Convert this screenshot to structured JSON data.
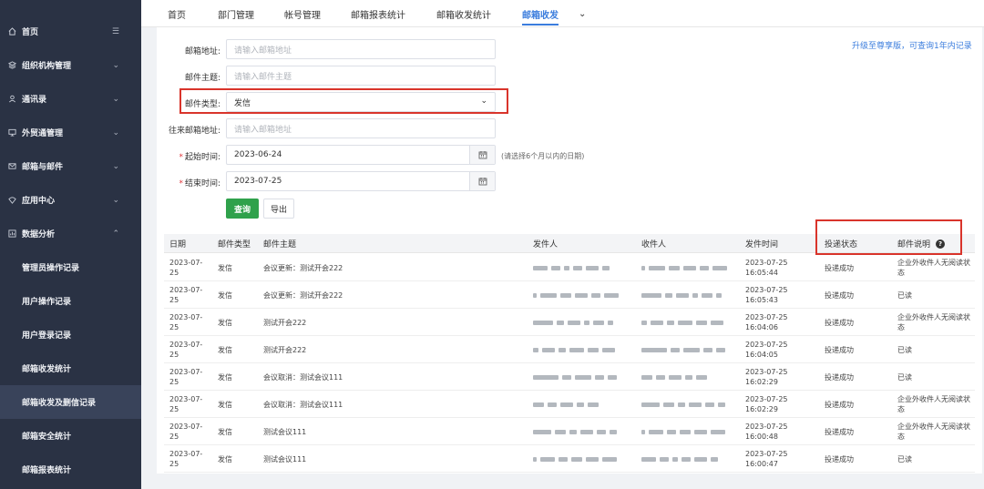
{
  "sidebar": {
    "items": [
      {
        "label": "首页",
        "icon": "home-icon",
        "arrow": "☰"
      },
      {
        "label": "组织机构管理",
        "icon": "org-icon",
        "arrow": "⌄"
      },
      {
        "label": "通讯录",
        "icon": "contacts-icon",
        "arrow": "⌄"
      },
      {
        "label": "外贸通管理",
        "icon": "monitor-icon",
        "arrow": "⌄"
      },
      {
        "label": "邮箱与邮件",
        "icon": "mail-icon",
        "arrow": "⌄"
      },
      {
        "label": "应用中心",
        "icon": "apps-icon",
        "arrow": "⌄"
      },
      {
        "label": "数据分析",
        "icon": "analytics-icon",
        "arrow": "⌃"
      }
    ],
    "sub_items": [
      {
        "label": "管理员操作记录",
        "active": false
      },
      {
        "label": "用户操作记录",
        "active": false
      },
      {
        "label": "用户登录记录",
        "active": false
      },
      {
        "label": "邮箱收发统计",
        "active": false
      },
      {
        "label": "邮箱收发及删信记录",
        "active": true
      },
      {
        "label": "邮箱安全统计",
        "active": false
      },
      {
        "label": "邮箱报表统计",
        "active": false
      }
    ]
  },
  "tabs": [
    {
      "label": "首页",
      "active": false
    },
    {
      "label": "部门管理",
      "active": false
    },
    {
      "label": "帐号管理",
      "active": false
    },
    {
      "label": "邮箱报表统计",
      "active": false
    },
    {
      "label": "邮箱收发统计",
      "active": false
    },
    {
      "label": "邮箱收发",
      "active": true
    },
    {
      "label": "⌄",
      "active": false
    }
  ],
  "form": {
    "mail_address_label": "邮箱地址:",
    "mail_address_placeholder": "请输入邮箱地址",
    "subject_label": "邮件主题:",
    "subject_placeholder": "请输入邮件主题",
    "type_label": "邮件类型:",
    "type_value": "发信",
    "peer_label": "往来邮箱地址:",
    "peer_placeholder": "请输入邮箱地址",
    "required_mark": "*",
    "start_label": "起始时间:",
    "start_value": "2023-06-24",
    "start_hint": "(请选择6个月以内的日期)",
    "end_label": "结束时间:",
    "end_value": "2023-07-25",
    "query_button": "查询",
    "export_button": "导出"
  },
  "upgrade_link": "升级至尊享版，可查询1年内记录",
  "table": {
    "headers": [
      "日期",
      "邮件类型",
      "邮件主题",
      "发件人",
      "收件人",
      "发件时间",
      "投递状态",
      "邮件说明"
    ],
    "rows": [
      {
        "date": "2023-07-25",
        "type": "发信",
        "subject": "会议更新：测试开会222",
        "time": "2023-07-25 16:05:44",
        "status": "投递成功",
        "note": "企业外收件人无阅读状态"
      },
      {
        "date": "2023-07-25",
        "type": "发信",
        "subject": "会议更新：测试开会222",
        "time": "2023-07-25 16:05:43",
        "status": "投递成功",
        "note": "已读"
      },
      {
        "date": "2023-07-25",
        "type": "发信",
        "subject": "测试开会222",
        "time": "2023-07-25 16:04:06",
        "status": "投递成功",
        "note": "企业外收件人无阅读状态"
      },
      {
        "date": "2023-07-25",
        "type": "发信",
        "subject": "测试开会222",
        "time": "2023-07-25 16:04:05",
        "status": "投递成功",
        "note": "已读"
      },
      {
        "date": "2023-07-25",
        "type": "发信",
        "subject": "会议取消：测试会议111",
        "time": "2023-07-25 16:02:29",
        "status": "投递成功",
        "note": "已读"
      },
      {
        "date": "2023-07-25",
        "type": "发信",
        "subject": "会议取消：测试会议111",
        "time": "2023-07-25 16:02:29",
        "status": "投递成功",
        "note": "企业外收件人无阅读状态"
      },
      {
        "date": "2023-07-25",
        "type": "发信",
        "subject": "测试会议111",
        "time": "2023-07-25 16:00:48",
        "status": "投递成功",
        "note": "企业外收件人无阅读状态"
      },
      {
        "date": "2023-07-25",
        "type": "发信",
        "subject": "测试会议111",
        "time": "2023-07-25 16:00:47",
        "status": "投递成功",
        "note": "已读"
      }
    ]
  },
  "colors": {
    "sidebar_bg": "#2a3244",
    "accent": "#3b7ddd",
    "primary_button": "#2fa14b",
    "highlight_box": "#d9342b"
  }
}
